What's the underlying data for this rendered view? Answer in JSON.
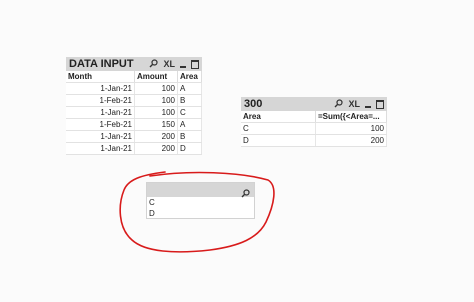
{
  "data_input": {
    "title": "DATA INPUT",
    "icon_search": "search-icon",
    "icon_xl": "XL",
    "columns": [
      "Month",
      "Amount",
      "Area"
    ],
    "rows": [
      [
        "1-Jan-21",
        "100",
        "A"
      ],
      [
        "1-Feb-21",
        "100",
        "B"
      ],
      [
        "1-Jan-21",
        "100",
        "C"
      ],
      [
        "1-Feb-21",
        "150",
        "A"
      ],
      [
        "1-Jan-21",
        "200",
        "B"
      ],
      [
        "1-Jan-21",
        "200",
        "D"
      ]
    ]
  },
  "chart_300": {
    "title": "300",
    "icon_xl": "XL",
    "columns": [
      "Area",
      "=Sum({<Area=..."
    ],
    "rows": [
      [
        "C",
        "100"
      ],
      [
        "D",
        "200"
      ]
    ]
  },
  "listbox": {
    "items": [
      "C",
      "D"
    ]
  },
  "colors": {
    "caption_bg": "#d6d6d6",
    "annotation_red": "#d81b1b"
  }
}
